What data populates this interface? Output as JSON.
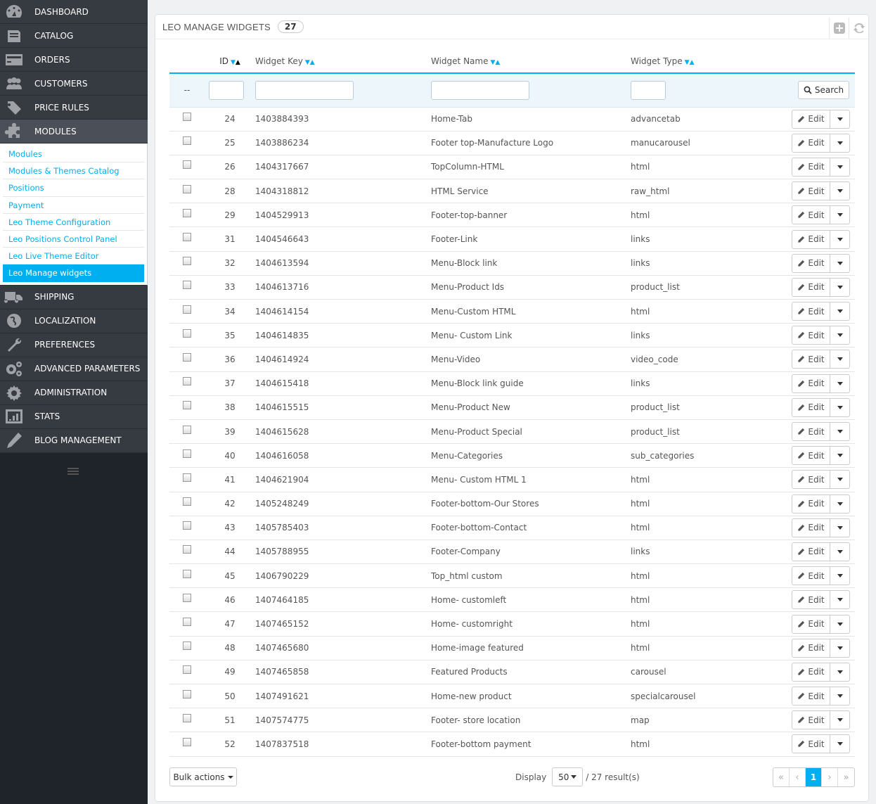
{
  "sidebar": {
    "top_items": [
      {
        "label": "DASHBOARD",
        "icon": "dashboard-icon"
      },
      {
        "label": "CATALOG",
        "icon": "catalog-icon"
      },
      {
        "label": "ORDERS",
        "icon": "orders-icon"
      },
      {
        "label": "CUSTOMERS",
        "icon": "customers-icon"
      },
      {
        "label": "PRICE RULES",
        "icon": "price-rules-icon"
      },
      {
        "label": "MODULES",
        "icon": "modules-icon"
      }
    ],
    "submenu": [
      "Modules",
      "Modules & Themes Catalog",
      "Positions",
      "Payment",
      "Leo Theme Configuration",
      "Leo Positions Control Panel",
      "Leo Live Theme Editor",
      "Leo Manage widgets"
    ],
    "bottom_items": [
      {
        "label": "SHIPPING",
        "icon": "shipping-icon"
      },
      {
        "label": "LOCALIZATION",
        "icon": "localization-icon"
      },
      {
        "label": "PREFERENCES",
        "icon": "preferences-icon"
      },
      {
        "label": "ADVANCED PARAMETERS",
        "icon": "advanced-parameters-icon"
      },
      {
        "label": "ADMINISTRATION",
        "icon": "administration-icon"
      },
      {
        "label": "STATS",
        "icon": "stats-icon"
      },
      {
        "label": "BLOG MANAGEMENT",
        "icon": "blog-management-icon"
      }
    ]
  },
  "panel": {
    "title": "LEO MANAGE WIDGETS",
    "count": "27"
  },
  "table": {
    "headers": {
      "id": "ID",
      "key": "Widget Key",
      "name": "Widget Name",
      "type": "Widget Type"
    },
    "filter_placeholder": "--",
    "search_label": "Search",
    "edit_label": "Edit",
    "rows": [
      {
        "id": "24",
        "key": "1403884393",
        "name": "Home-Tab",
        "type": "advancetab"
      },
      {
        "id": "25",
        "key": "1403886234",
        "name": "Footer top-Manufacture Logo",
        "type": "manucarousel"
      },
      {
        "id": "26",
        "key": "1404317667",
        "name": "TopColumn-HTML",
        "type": "html"
      },
      {
        "id": "28",
        "key": "1404318812",
        "name": "HTML Service",
        "type": "raw_html"
      },
      {
        "id": "29",
        "key": "1404529913",
        "name": "Footer-top-banner",
        "type": "html"
      },
      {
        "id": "31",
        "key": "1404546643",
        "name": "Footer-Link",
        "type": "links"
      },
      {
        "id": "32",
        "key": "1404613594",
        "name": "Menu-Block link",
        "type": "links"
      },
      {
        "id": "33",
        "key": "1404613716",
        "name": "Menu-Product Ids",
        "type": "product_list"
      },
      {
        "id": "34",
        "key": "1404614154",
        "name": "Menu-Custom HTML",
        "type": "html"
      },
      {
        "id": "35",
        "key": "1404614835",
        "name": "Menu- Custom Link",
        "type": "links"
      },
      {
        "id": "36",
        "key": "1404614924",
        "name": "Menu-Video",
        "type": "video_code"
      },
      {
        "id": "37",
        "key": "1404615418",
        "name": "Menu-Block link guide",
        "type": "links"
      },
      {
        "id": "38",
        "key": "1404615515",
        "name": "Menu-Product New",
        "type": "product_list"
      },
      {
        "id": "39",
        "key": "1404615628",
        "name": "Menu-Product Special",
        "type": "product_list"
      },
      {
        "id": "40",
        "key": "1404616058",
        "name": "Menu-Categories",
        "type": "sub_categories"
      },
      {
        "id": "41",
        "key": "1404621904",
        "name": "Menu- Custom HTML 1",
        "type": "html"
      },
      {
        "id": "42",
        "key": "1405248249",
        "name": "Footer-bottom-Our Stores",
        "type": "html"
      },
      {
        "id": "43",
        "key": "1405785403",
        "name": "Footer-bottom-Contact",
        "type": "html"
      },
      {
        "id": "44",
        "key": "1405788955",
        "name": "Footer-Company",
        "type": "links"
      },
      {
        "id": "45",
        "key": "1406790229",
        "name": "Top_html custom",
        "type": "html"
      },
      {
        "id": "46",
        "key": "1407464185",
        "name": "Home- customleft",
        "type": "html"
      },
      {
        "id": "47",
        "key": "1407465152",
        "name": "Home- customright",
        "type": "html"
      },
      {
        "id": "48",
        "key": "1407465680",
        "name": "Home-image featured",
        "type": "html"
      },
      {
        "id": "49",
        "key": "1407465858",
        "name": "Featured Products",
        "type": "carousel"
      },
      {
        "id": "50",
        "key": "1407491621",
        "name": "Home-new product",
        "type": "specialcarousel"
      },
      {
        "id": "51",
        "key": "1407574775",
        "name": "Footer- store location",
        "type": "map"
      },
      {
        "id": "52",
        "key": "1407837518",
        "name": "Footer-bottom payment",
        "type": "html"
      }
    ]
  },
  "footer": {
    "bulk_label": "Bulk actions",
    "display_label": "Display",
    "per_page": "50",
    "results": "/ 27 result(s)",
    "first": "«",
    "prev": "‹",
    "current_page": "1",
    "next": "›",
    "last": "»"
  },
  "colors": {
    "accent": "#00aff0",
    "sidebar": "#363a41"
  }
}
